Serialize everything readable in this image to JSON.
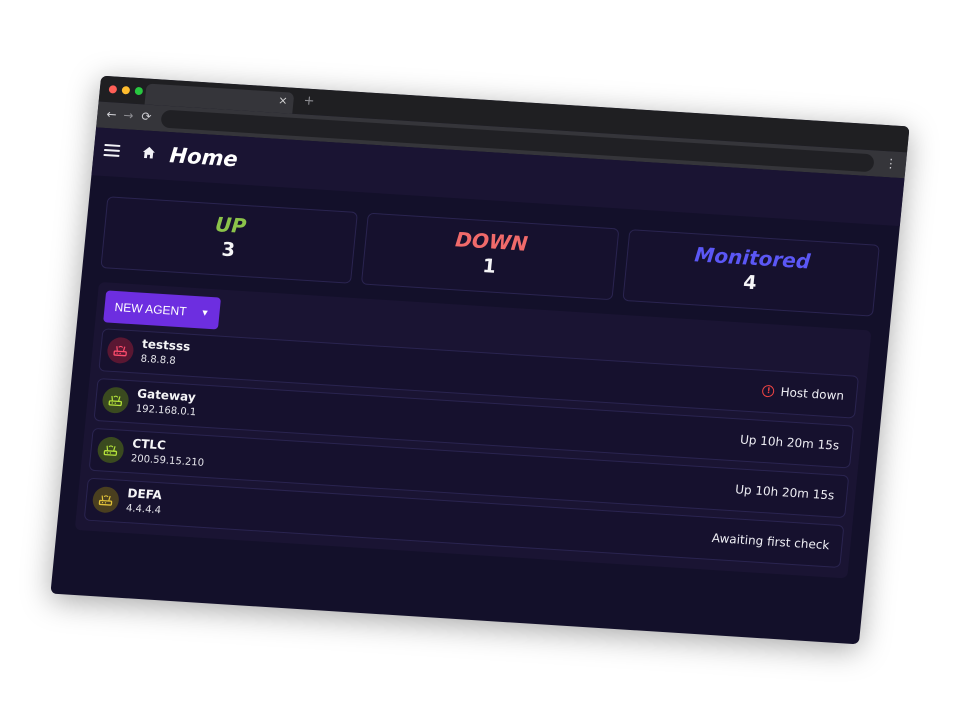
{
  "app": {
    "title": "Home"
  },
  "browser": {
    "tab_close": "×",
    "new_tab": "+",
    "back": "←",
    "forward": "→",
    "reload": "⟳",
    "menu": "⋮"
  },
  "stats": [
    {
      "label": "UP",
      "value": "3",
      "color": "#8bc34a"
    },
    {
      "label": "DOWN",
      "value": "1",
      "color": "#f06a6a"
    },
    {
      "label": "Monitored",
      "value": "4",
      "color": "#5b57f5"
    }
  ],
  "actions": {
    "new_agent_label": "NEW AGENT"
  },
  "agents": [
    {
      "name": "testsss",
      "ip": "8.8.8.8",
      "status": "Host down",
      "icon": "router-icon",
      "icon_bg": "#5a1732",
      "icon_color": "#ff4d6d",
      "alert": true
    },
    {
      "name": "Gateway",
      "ip": "192.168.0.1",
      "status": "Up 10h 20m 15s",
      "icon": "router-icon",
      "icon_bg": "#3a4a1f",
      "icon_color": "#b5e33b",
      "alert": false
    },
    {
      "name": "CTLC",
      "ip": "200.59.15.210",
      "status": "Up 10h 20m 15s",
      "icon": "router-icon",
      "icon_bg": "#3a4a1f",
      "icon_color": "#b5e33b",
      "alert": false
    },
    {
      "name": "DEFA",
      "ip": "4.4.4.4",
      "status": "Awaiting first check",
      "icon": "router-icon",
      "icon_bg": "#4a3f1f",
      "icon_color": "#e0c13a",
      "alert": false
    }
  ]
}
